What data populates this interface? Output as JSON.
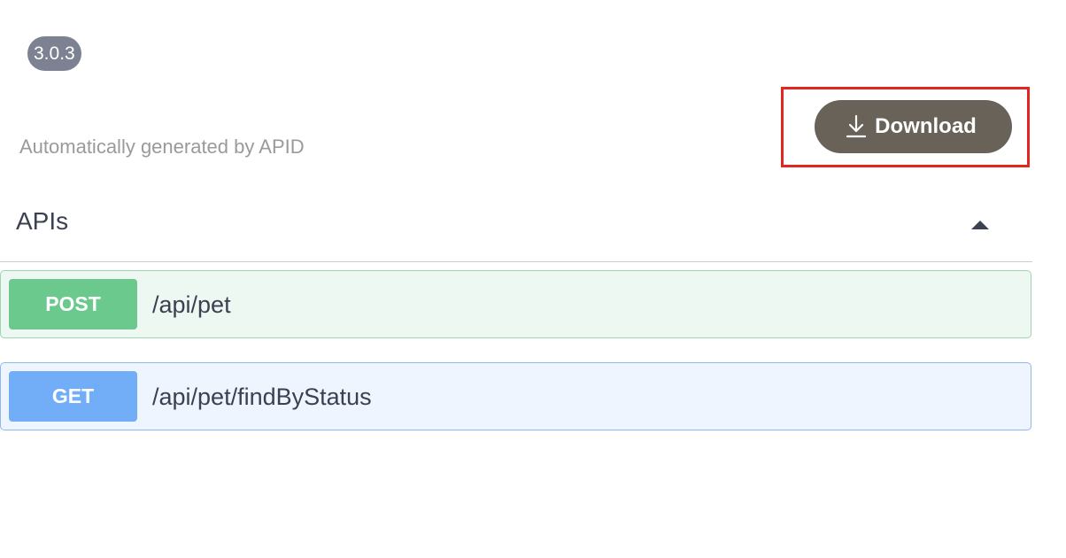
{
  "header": {
    "version": "3.0.3",
    "description": "Automatically generated by APID"
  },
  "toolbar": {
    "download_label": "Download",
    "download_icon": "download-icon",
    "highlight_color": "#e3261f"
  },
  "section": {
    "title": "APIs",
    "toggle_icon": "caret-up-icon",
    "expanded": true
  },
  "operations": [
    {
      "method": "POST",
      "path": "/api/pet",
      "color": "#6bc98e"
    },
    {
      "method": "GET",
      "path": "/api/pet/findByStatus",
      "color": "#72adf7"
    }
  ]
}
